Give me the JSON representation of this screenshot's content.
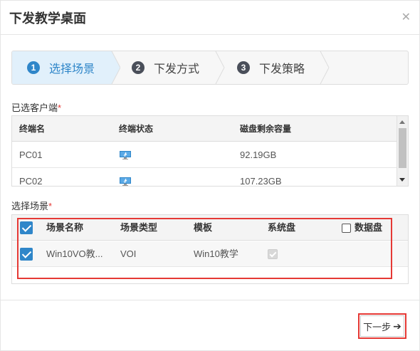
{
  "dialog": {
    "title": "下发教学桌面",
    "close_icon": "close-icon"
  },
  "stepper": {
    "steps": [
      {
        "num": "1",
        "label": "选择场景",
        "active": true
      },
      {
        "num": "2",
        "label": "下发方式",
        "active": false
      },
      {
        "num": "3",
        "label": "下发策略",
        "active": false
      }
    ]
  },
  "clients": {
    "label": "已选客户端",
    "required_mark": "*",
    "columns": [
      "终端名",
      "终端状态",
      "磁盘剩余容量"
    ],
    "rows": [
      {
        "name": "PC01",
        "status_icon": "monitor-icon",
        "disk": "92.19GB"
      },
      {
        "name": "PC02",
        "status_icon": "monitor-icon",
        "disk": "107.23GB"
      }
    ]
  },
  "scenes": {
    "label": "选择场景",
    "required_mark": "*",
    "header_checked": true,
    "columns": [
      "场景名称",
      "场景类型",
      "模板",
      "系统盘",
      "数据盘"
    ],
    "rows": [
      {
        "checked": true,
        "name": "Win10VO教...",
        "type": "VOI",
        "template": "Win10教学",
        "system_disk": true
      }
    ]
  },
  "footer": {
    "next_label": "下一步",
    "next_icon": "arrow-right-icon"
  },
  "colors": {
    "accent": "#2f86c9",
    "highlight": "#e53935"
  }
}
